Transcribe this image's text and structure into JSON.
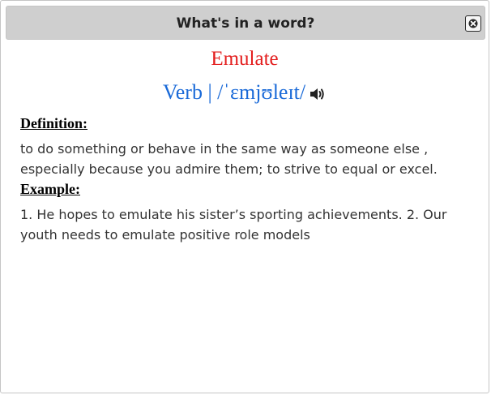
{
  "dialog": {
    "title": "What's in a word?",
    "close_icon": "close-icon"
  },
  "entry": {
    "word": "Emulate",
    "pos_pronunciation": "Verb | /ˈɛmjʊleɪt/",
    "speaker_icon": "speaker-icon",
    "definition_label": "Definition:",
    "definition_text": "to do something or behave in the same way as someone else , especially because you admire them; to strive to equal or excel.",
    "example_label": "Example:",
    "example_text": "1. He hopes to emulate his sister’s sporting achievements. 2. Our youth needs to emulate positive role models"
  },
  "colors": {
    "word": "#e31e1e",
    "pronunciation": "#1a6ad8",
    "titlebar": "#cfcfcf"
  }
}
